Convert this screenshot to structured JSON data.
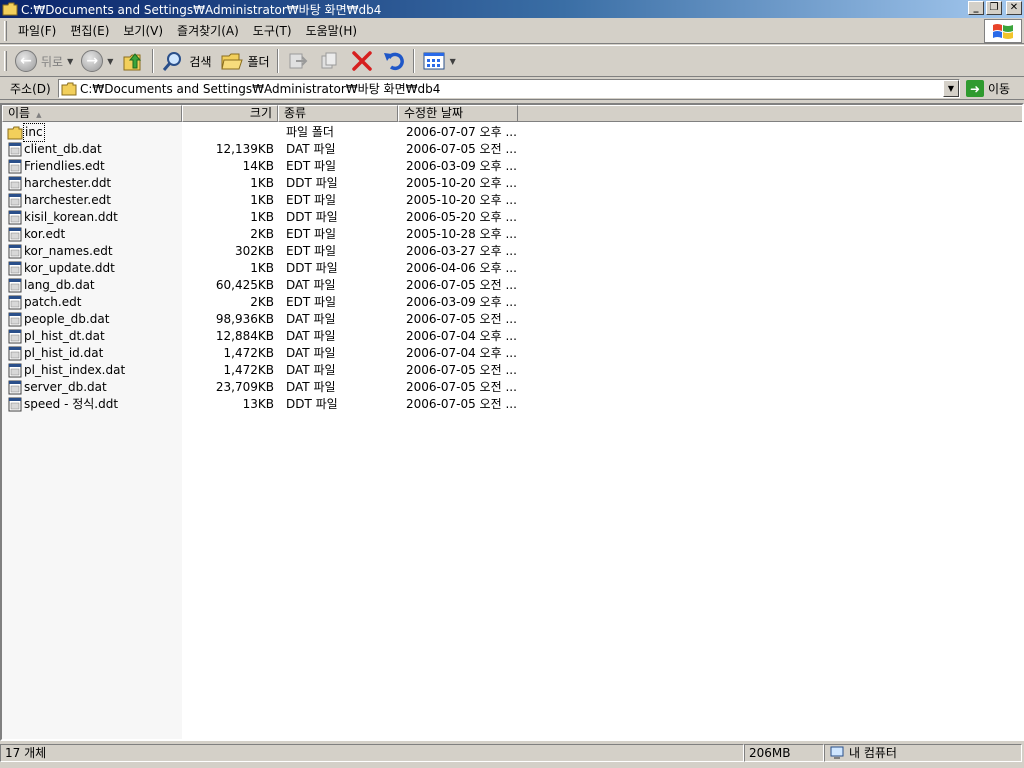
{
  "window": {
    "title": "C:₩Documents and Settings₩Administrator₩바탕 화면₩db4",
    "buttons": {
      "minimize": "_",
      "maximize": "❐",
      "close": "✕"
    }
  },
  "menu": [
    "파일(F)",
    "편집(E)",
    "보기(V)",
    "즐겨찾기(A)",
    "도구(T)",
    "도움말(H)"
  ],
  "toolbar": {
    "back": "뒤로",
    "search": "검색",
    "folders": "폴더"
  },
  "address": {
    "label": "주소(D)",
    "value": "C:₩Documents and Settings₩Administrator₩바탕 화면₩db4",
    "go": "이동"
  },
  "columns": {
    "name": "이름",
    "size": "크기",
    "type": "종류",
    "date": "수정한 날짜"
  },
  "files": [
    {
      "name": "inc",
      "size": "",
      "type": "파일 폴더",
      "date": "2006-07-07 오후 ...",
      "folder": true
    },
    {
      "name": "client_db.dat",
      "size": "12,139KB",
      "type": "DAT 파일",
      "date": "2006-07-05 오전 ..."
    },
    {
      "name": "Friendlies.edt",
      "size": "14KB",
      "type": "EDT 파일",
      "date": "2006-03-09 오후 ..."
    },
    {
      "name": "harchester.ddt",
      "size": "1KB",
      "type": "DDT 파일",
      "date": "2005-10-20 오후 ..."
    },
    {
      "name": "harchester.edt",
      "size": "1KB",
      "type": "EDT 파일",
      "date": "2005-10-20 오후 ..."
    },
    {
      "name": "kisil_korean.ddt",
      "size": "1KB",
      "type": "DDT 파일",
      "date": "2006-05-20 오후 ..."
    },
    {
      "name": "kor.edt",
      "size": "2KB",
      "type": "EDT 파일",
      "date": "2005-10-28 오후 ..."
    },
    {
      "name": "kor_names.edt",
      "size": "302KB",
      "type": "EDT 파일",
      "date": "2006-03-27 오후 ..."
    },
    {
      "name": "kor_update.ddt",
      "size": "1KB",
      "type": "DDT 파일",
      "date": "2006-04-06 오후 ..."
    },
    {
      "name": "lang_db.dat",
      "size": "60,425KB",
      "type": "DAT 파일",
      "date": "2006-07-05 오전 ..."
    },
    {
      "name": "patch.edt",
      "size": "2KB",
      "type": "EDT 파일",
      "date": "2006-03-09 오후 ..."
    },
    {
      "name": "people_db.dat",
      "size": "98,936KB",
      "type": "DAT 파일",
      "date": "2006-07-05 오전 ..."
    },
    {
      "name": "pl_hist_dt.dat",
      "size": "12,884KB",
      "type": "DAT 파일",
      "date": "2006-07-04 오후 ..."
    },
    {
      "name": "pl_hist_id.dat",
      "size": "1,472KB",
      "type": "DAT 파일",
      "date": "2006-07-04 오후 ..."
    },
    {
      "name": "pl_hist_index.dat",
      "size": "1,472KB",
      "type": "DAT 파일",
      "date": "2006-07-05 오전 ..."
    },
    {
      "name": "server_db.dat",
      "size": "23,709KB",
      "type": "DAT 파일",
      "date": "2006-07-05 오전 ..."
    },
    {
      "name": "speed - 정식.ddt",
      "size": "13KB",
      "type": "DDT 파일",
      "date": "2006-07-05 오전 ..."
    }
  ],
  "status": {
    "count": "17 개체",
    "size": "206MB",
    "zone": "내 컴퓨터"
  },
  "colors": {
    "title_start": "#0a246a",
    "title_end": "#a6caf0",
    "chrome": "#d4d0c8",
    "folder": "#f2cf5b"
  }
}
